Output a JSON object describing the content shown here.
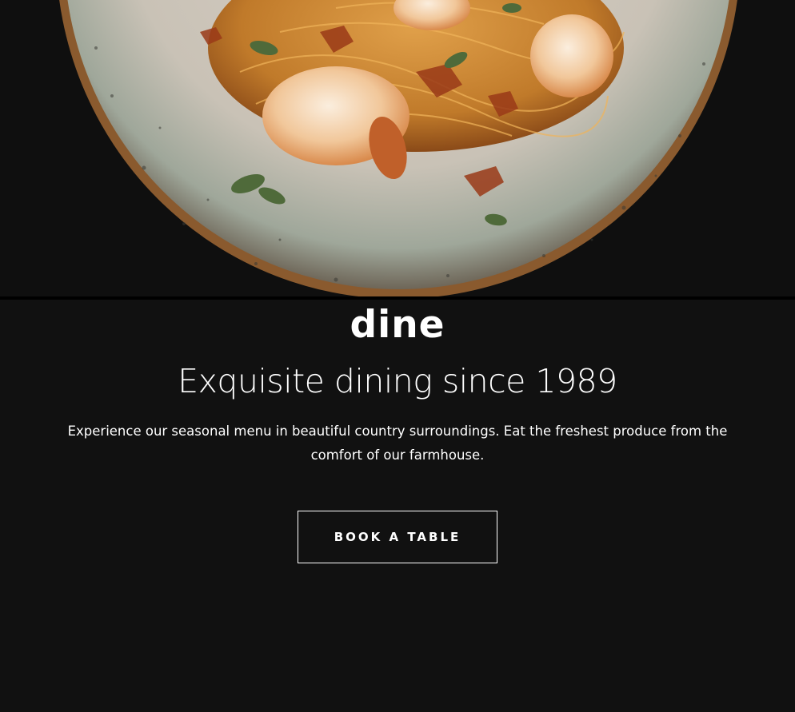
{
  "hero": {
    "image": "plate-of-shrimp-pasta"
  },
  "brand": {
    "logo_text": "dine"
  },
  "main": {
    "headline": "Exquisite dining since 1989",
    "description": "Experience our seasonal menu in beautiful country surroundings. Eat the freshest produce from the comfort of our farmhouse.",
    "cta_label": "BOOK A TABLE"
  },
  "colors": {
    "background": "#111111",
    "text": "#ffffff",
    "button_border": "#ffffff"
  }
}
